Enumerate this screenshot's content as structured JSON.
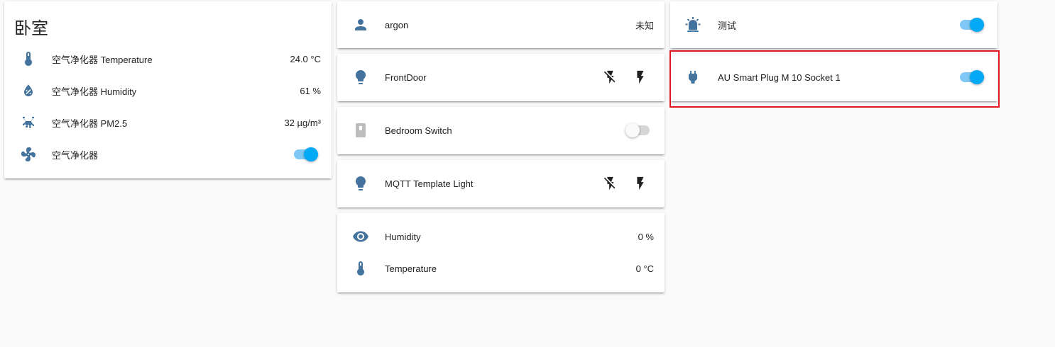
{
  "colors": {
    "icon": "#44739e",
    "toggle_on": "#03a9f4",
    "highlight": "#e0171d",
    "background": "#fafafa"
  },
  "bedroom_card": {
    "title": "卧室",
    "rows": [
      {
        "icon": "thermometer-icon",
        "label": "空气净化器 Temperature",
        "value": "24.0 °C"
      },
      {
        "icon": "water-percent-icon",
        "label": "空气净化器 Humidity",
        "value": "61 %"
      },
      {
        "icon": "air-particles-icon",
        "label": "空气净化器 PM2.5",
        "value": "32 µg/m³"
      },
      {
        "icon": "fan-icon",
        "label": "空气净化器",
        "toggle": "on"
      }
    ]
  },
  "middle_cards": {
    "argon": {
      "icon": "person-icon",
      "label": "argon",
      "value": "未知"
    },
    "frontdoor": {
      "icon": "lightbulb-icon",
      "label": "FrontDoor",
      "buttons": [
        "flash-off-icon",
        "flash-icon"
      ]
    },
    "bedroom_switch": {
      "icon": "switch-icon",
      "label": "Bedroom Switch",
      "toggle": "off"
    },
    "mqtt_light": {
      "icon": "lightbulb-icon",
      "label": "MQTT Template Light",
      "buttons": [
        "flash-off-icon",
        "flash-icon"
      ]
    },
    "sensors": [
      {
        "icon": "eye-icon",
        "label": "Humidity",
        "value": "0 %"
      },
      {
        "icon": "thermometer-icon",
        "label": "Temperature",
        "value": "0 °C"
      }
    ]
  },
  "right_cards": {
    "test": {
      "icon": "alarm-light-icon",
      "label": "测试",
      "toggle": "on"
    },
    "plug": {
      "icon": "power-plug-icon",
      "label": "AU Smart Plug M 10 Socket 1",
      "toggle": "on"
    }
  }
}
